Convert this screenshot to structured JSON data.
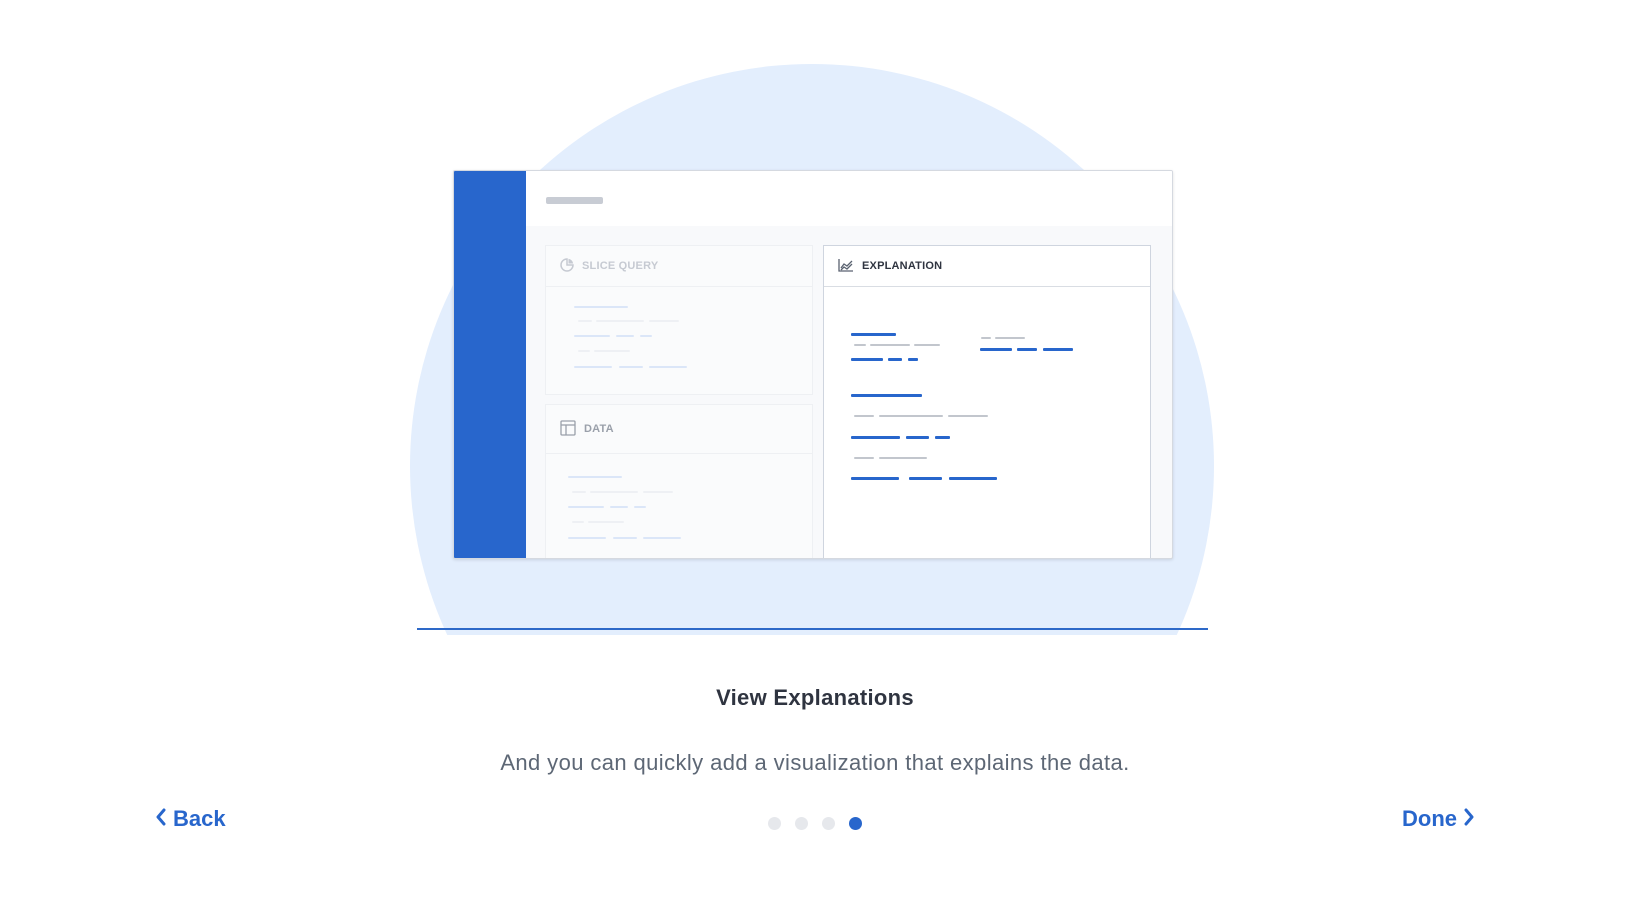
{
  "illustration": {
    "slice_query_label": "SLICE QUERY",
    "data_label": "DATA",
    "explanation_label": "EXPLANATION",
    "icons": [
      "pie-chart-icon",
      "table-icon",
      "area-chart-icon"
    ],
    "colors": {
      "accent": "#2866cc",
      "circle": "#e3eefd",
      "text": "#2f3440"
    }
  },
  "content": {
    "title": "View Explanations",
    "description": "And you can quickly add a visualization that explains the data."
  },
  "nav": {
    "back_label": "Back",
    "done_label": "Done",
    "back_icon": "chevron-left-icon",
    "done_icon": "chevron-right-icon"
  },
  "pagination": {
    "total": 4,
    "current": 4
  }
}
